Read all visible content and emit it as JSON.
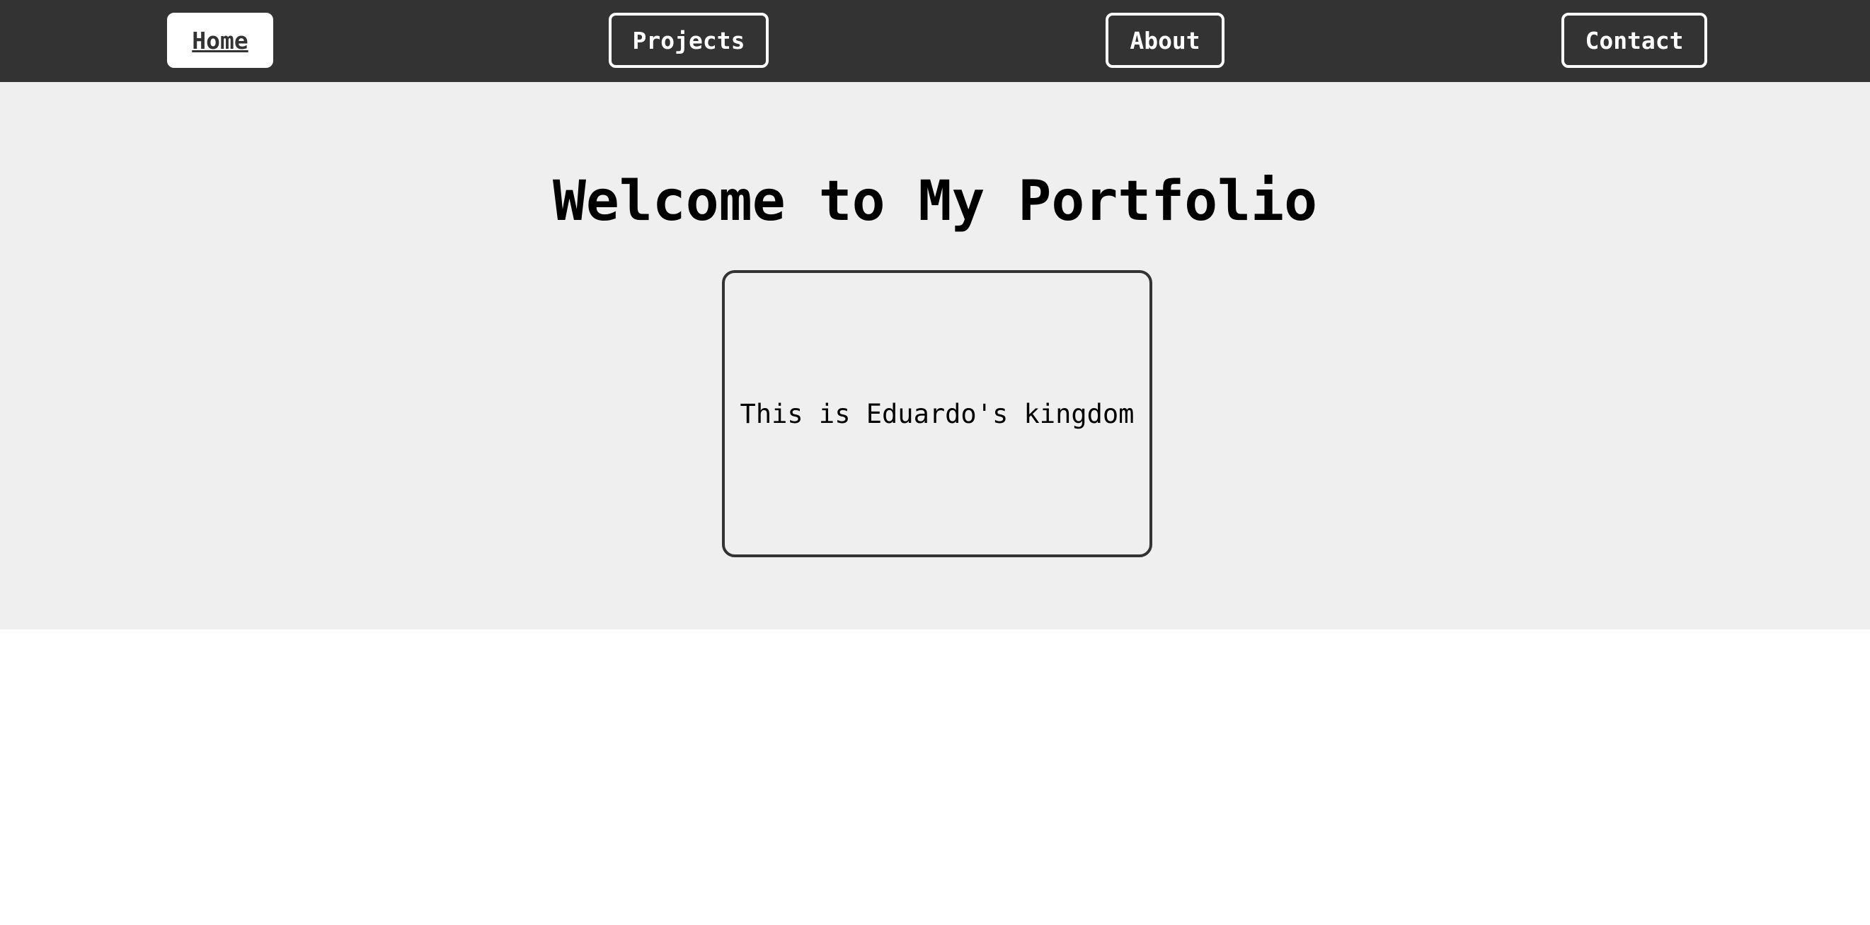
{
  "nav": {
    "items": [
      {
        "label": "Home",
        "active": true
      },
      {
        "label": "Projects",
        "active": false
      },
      {
        "label": "About",
        "active": false
      },
      {
        "label": "Contact",
        "active": false
      }
    ]
  },
  "hero": {
    "title": "Welcome to My Portfolio",
    "card_text": "This is Eduardo's kingdom"
  },
  "colors": {
    "navbar_bg": "#333333",
    "nav_border": "#ffffff",
    "hero_bg": "#efefef",
    "page_bg": "#ffffff",
    "text": "#000000"
  }
}
